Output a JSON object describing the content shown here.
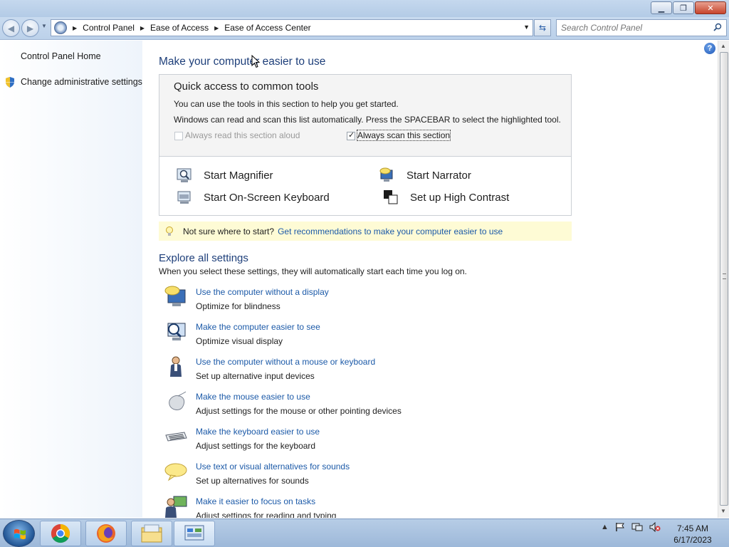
{
  "window": {
    "controls": {
      "minimize": "▁",
      "maximize": "❐",
      "close": "✕"
    }
  },
  "address_bar": {
    "breadcrumbs": [
      "Control Panel",
      "Ease of Access",
      "Ease of Access Center"
    ],
    "search_placeholder": "Search Control Panel"
  },
  "left_pane": {
    "home_link": "Control Panel Home",
    "admin_link": "Change administrative settings"
  },
  "main": {
    "heading": "Make your computer easier to use",
    "quick_access": {
      "title": "Quick access to common tools",
      "line1": "You can use the tools in this section to help you get started.",
      "line2": "Windows can read and scan this list automatically.  Press the SPACEBAR to select the highlighted tool.",
      "read_aloud": {
        "label": "Always read this section aloud",
        "checked": false,
        "disabled": true
      },
      "scan": {
        "label": "Always scan this section",
        "checked": true
      }
    },
    "tools": {
      "magnifier": "Start Magnifier",
      "narrator": "Start Narrator",
      "osk": "Start On-Screen Keyboard",
      "contrast": "Set up High Contrast"
    },
    "tip": {
      "text": "Not sure where to start?",
      "link": "Get recommendations to make your computer easier to use"
    },
    "explore": {
      "heading": "Explore all settings",
      "description": "When you select these settings, they will automatically start each time you log on."
    },
    "settings": [
      {
        "link": "Use the computer without a display",
        "desc": "Optimize for blindness",
        "icon": "monitor-speech-icon"
      },
      {
        "link": "Make the computer easier to see",
        "desc": "Optimize visual display",
        "icon": "monitor-magnifier-icon"
      },
      {
        "link": "Use the computer without a mouse or keyboard",
        "desc": "Set up alternative input devices",
        "icon": "person-icon"
      },
      {
        "link": "Make the mouse easier to use",
        "desc": "Adjust settings for the mouse or other pointing devices",
        "icon": "mouse-icon"
      },
      {
        "link": "Make the keyboard easier to use",
        "desc": "Adjust settings for the keyboard",
        "icon": "keyboard-icon"
      },
      {
        "link": "Use text or visual alternatives for sounds",
        "desc": "Set up alternatives for sounds",
        "icon": "speech-bubble-icon"
      },
      {
        "link": "Make it easier to focus on tasks",
        "desc": "Adjust settings for reading and typing",
        "icon": "person-monitor-icon"
      }
    ]
  },
  "taskbar": {
    "items": [
      "chrome-icon",
      "firefox-icon",
      "file-explorer-icon",
      "control-panel-icon"
    ],
    "clock_time": "7:45 AM",
    "clock_date": "6/17/2023"
  },
  "colors": {
    "link": "#1c5aa8",
    "heading": "#1e3f7a",
    "tip_background": "#fefbd5"
  }
}
